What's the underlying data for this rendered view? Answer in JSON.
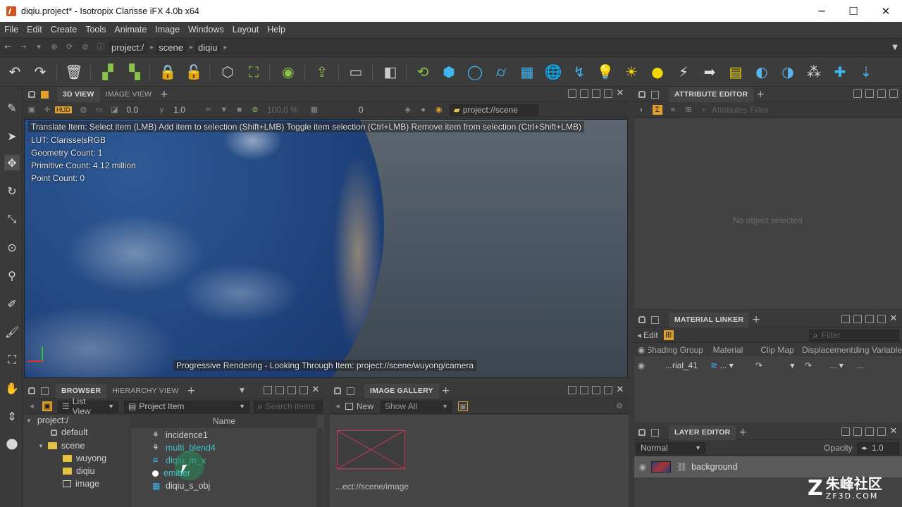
{
  "window": {
    "title": "diqiu.project* - Isotropix Clarisse iFX 4.0b x64",
    "controls": {
      "minimize": "─",
      "maximize": "☐",
      "close": "✕"
    }
  },
  "menu": [
    "File",
    "Edit",
    "Create",
    "Tools",
    "Animate",
    "Image",
    "Windows",
    "Layout",
    "Help"
  ],
  "path": [
    "project:/",
    "scene",
    "diqiu"
  ],
  "toolbar_icons": [
    "undo-icon",
    "redo-icon",
    "delete-icon",
    "group-icon",
    "ungroup-icon",
    "lock-icon",
    "unlock-icon",
    "box-icon",
    "isolate-icon",
    "import-icon",
    "export-icon",
    "message-icon",
    "instance-icon",
    "refresh-icon",
    "cube-icon",
    "sphere-icon",
    "cylinder-icon",
    "grid-icon",
    "globe-icon",
    "curve-icon",
    "light-bulb-icon",
    "sun-icon",
    "yellow-sphere-icon",
    "spotlight-icon",
    "distant-light-icon",
    "area-light-icon",
    "ocean-icon",
    "sky-icon",
    "particle-icon",
    "add-icon",
    "scatter-icon"
  ],
  "viewport_panel": {
    "tabs": [
      "3D VIEW",
      "IMAGE VIEW"
    ],
    "hud": "HUD",
    "value1": "0.0",
    "value2": "1.0",
    "zoom": "100.0 %",
    "frame": "0",
    "context": "project://scene",
    "hint": "Translate Item: Select item (LMB)  Add item to selection (Shift+LMB)  Toggle item selection (Ctrl+LMB)  Remove item from selection (Ctrl+Shift+LMB)",
    "info": [
      "LUT: ClarisseļsRGB",
      "Geometry Count: 1",
      "Primitive Count: 4.12 million",
      "Point Count: 0"
    ],
    "progress": "Progressive Rendering - Looking Through Item: project://scene/wuyong/camera"
  },
  "attribute_editor": {
    "title": "ATTRIBUTE EDITOR",
    "filter_placeholder": "Attributes Filter",
    "empty": "No object selected"
  },
  "material_linker": {
    "title": "MATERIAL LINKER",
    "edit": "Edit",
    "filter_placeholder": "Filter",
    "columns": [
      "Shading Group",
      "Material",
      "Clip Map",
      "Displacement",
      "Shading Variable"
    ],
    "row": [
      "...rial_41",
      "...",
      "...",
      "...",
      "..."
    ]
  },
  "layer_editor": {
    "title": "LAYER EDITOR",
    "blend": "Normal",
    "opacity_label": "Opacity",
    "opacity": "1.0",
    "layer": "background"
  },
  "browser": {
    "tabs": [
      "BROWSER",
      "HIERARCHY VIEW"
    ],
    "view_mode": "List View",
    "filter_type": "Project Item",
    "search_placeholder": "Search items",
    "tree": [
      "project:/",
      "default",
      "scene",
      "wuyong",
      "diqiu",
      "image"
    ],
    "column": "Name",
    "items": [
      "incidence1",
      "multi_blend4",
      "diqiu_m_x",
      "emitter",
      "diqiu_s_obj"
    ]
  },
  "image_gallery": {
    "title": "IMAGE GALLERY",
    "new": "New",
    "show": "Show All",
    "thumb_label": "...ect://scene/image"
  },
  "watermark": {
    "cn": "朱峰社区",
    "site": "ZF3D.COM"
  },
  "colors": {
    "accent_green": "#8bc34a",
    "folder": "#e6c244",
    "link_teal": "#3fc1c9",
    "sun": "#f2d600"
  }
}
